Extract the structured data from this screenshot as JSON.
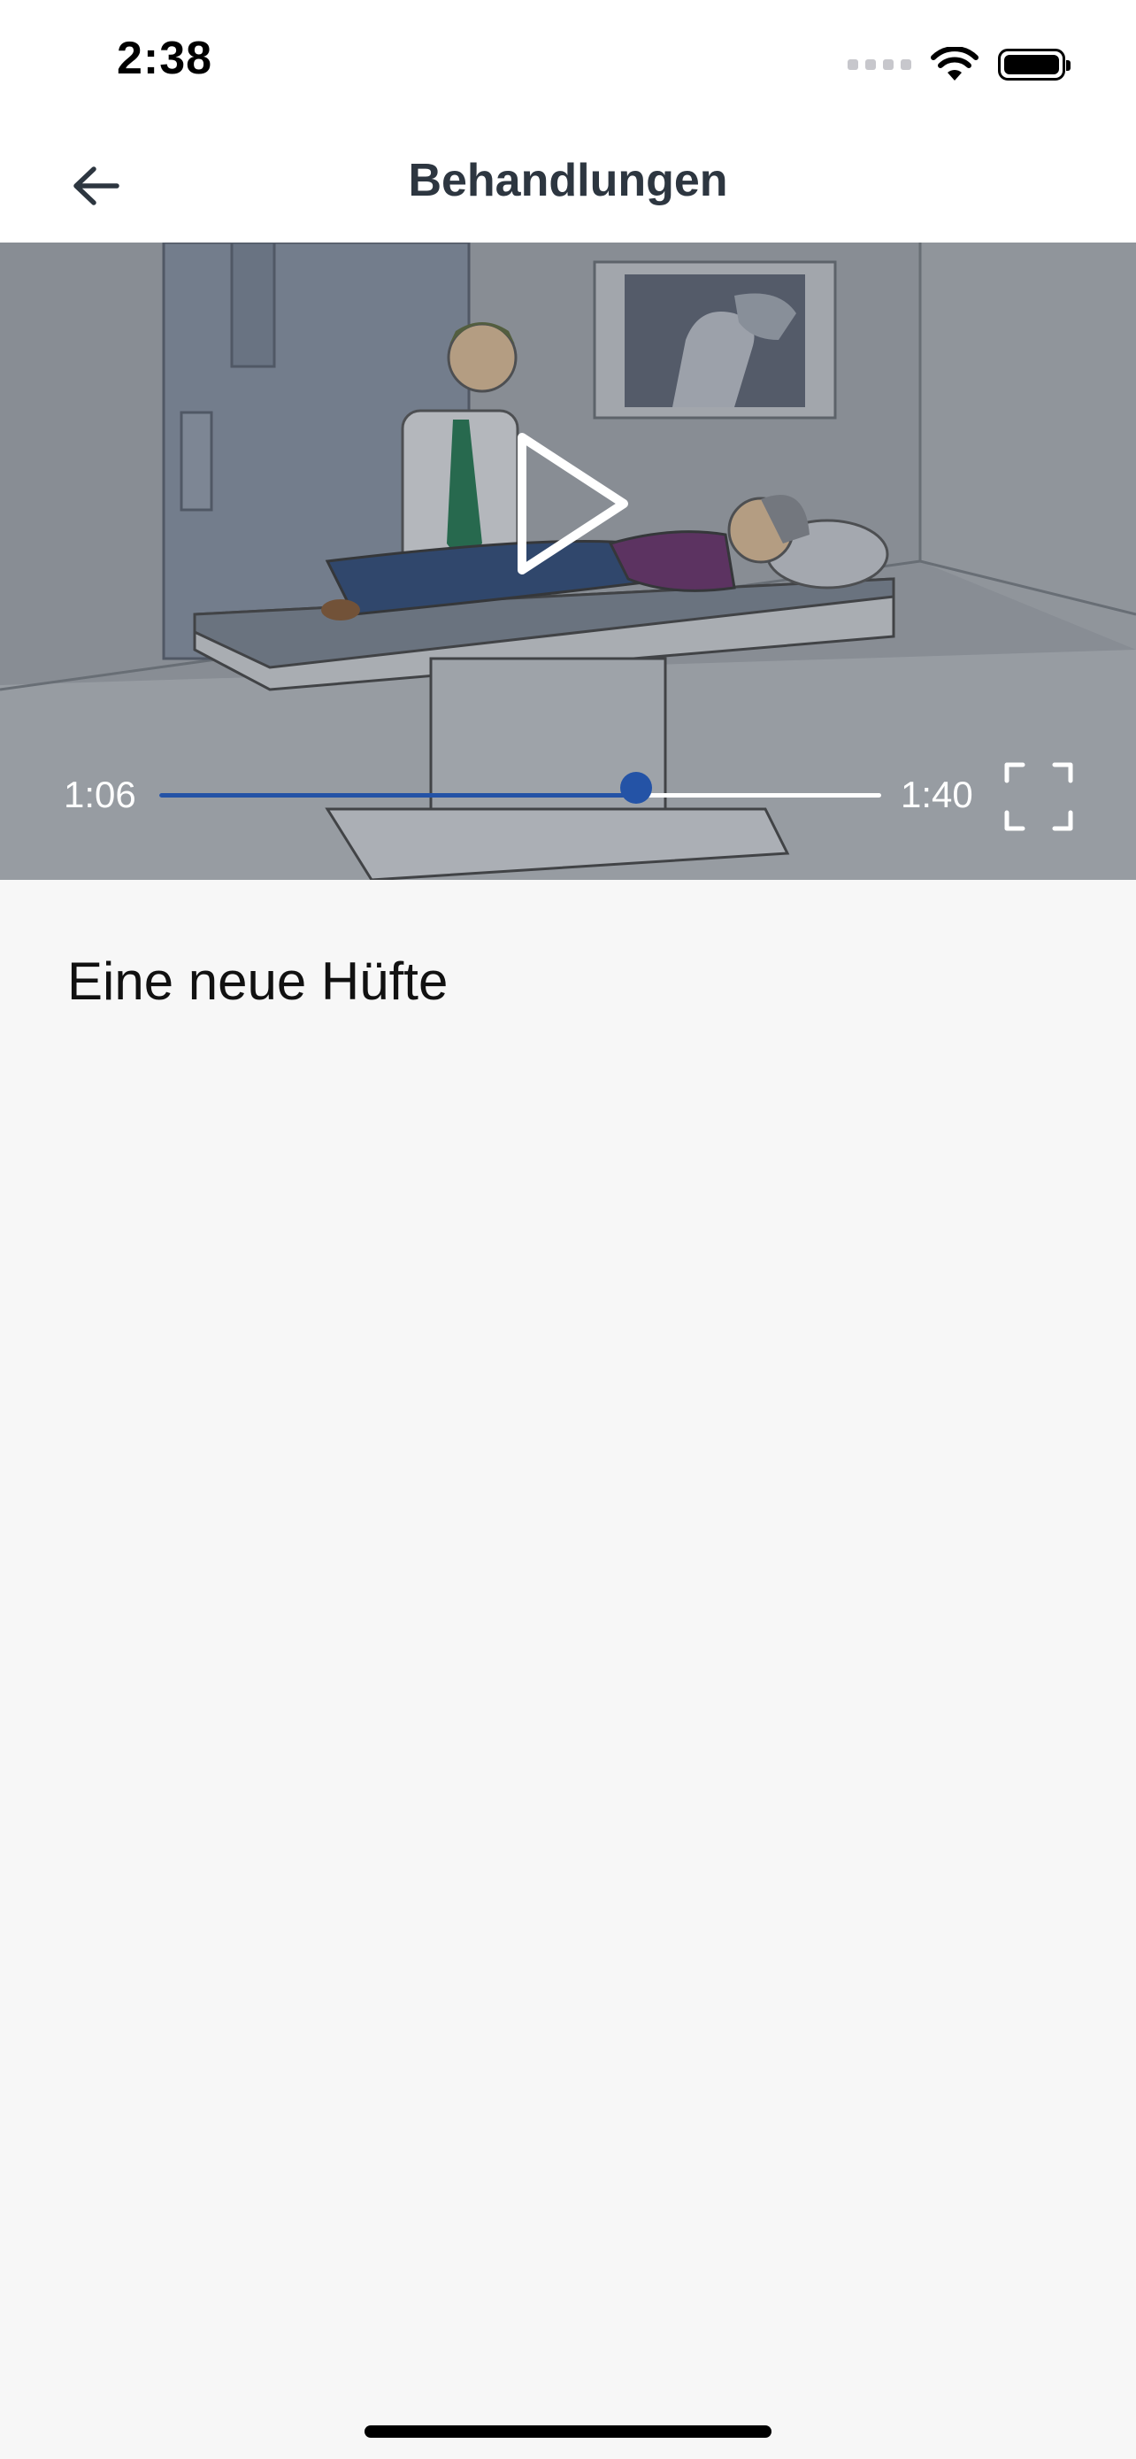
{
  "status_bar": {
    "time": "2:38",
    "icons": [
      "signal-icon",
      "wifi-icon",
      "battery-icon"
    ]
  },
  "nav": {
    "back_icon": "arrow-left-icon",
    "title": "Behandlungen"
  },
  "video": {
    "current_time": "1:06",
    "duration": "1:40",
    "progress": 0.66,
    "play_icon": "play-icon",
    "fullscreen_icon": "fullscreen-icon",
    "accent_color": "#2453a6"
  },
  "content": {
    "title": "Eine neue Hüfte"
  }
}
